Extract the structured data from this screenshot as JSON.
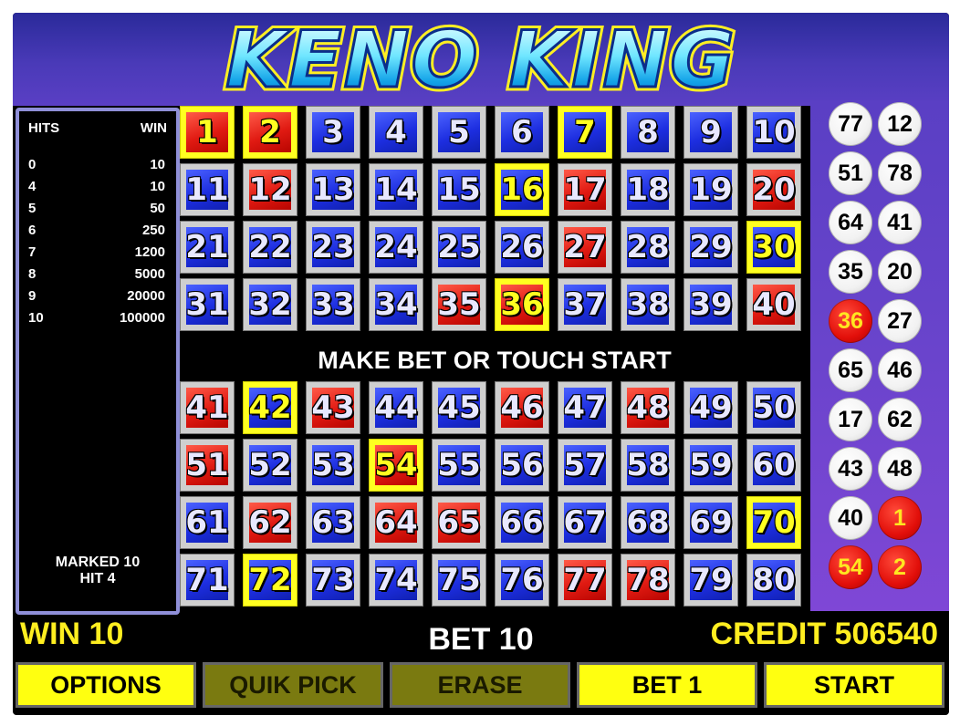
{
  "title": "KENO KING",
  "paytable": {
    "header_hits": "HITS",
    "header_win": "WIN",
    "rows": [
      {
        "hits": "0",
        "win": "10"
      },
      {
        "hits": "4",
        "win": "10"
      },
      {
        "hits": "5",
        "win": "50"
      },
      {
        "hits": "6",
        "win": "250"
      },
      {
        "hits": "7",
        "win": "1200"
      },
      {
        "hits": "8",
        "win": "5000"
      },
      {
        "hits": "9",
        "win": "20000"
      },
      {
        "hits": "10",
        "win": "100000"
      }
    ],
    "marked": "MARKED 10",
    "hit": "HIT 4"
  },
  "board": {
    "message": "MAKE BET OR TOUCH START",
    "drawn": [
      1,
      2,
      12,
      17,
      20,
      27,
      35,
      36,
      40,
      41,
      43,
      46,
      48,
      51,
      54,
      62,
      64,
      65,
      77,
      78
    ],
    "marked": [
      1,
      2,
      7,
      16,
      30,
      36,
      42,
      54,
      70,
      72
    ]
  },
  "drawn_balls": [
    {
      "n": "77",
      "hit": false
    },
    {
      "n": "12",
      "hit": false
    },
    {
      "n": "51",
      "hit": false
    },
    {
      "n": "78",
      "hit": false
    },
    {
      "n": "64",
      "hit": false
    },
    {
      "n": "41",
      "hit": false
    },
    {
      "n": "35",
      "hit": false
    },
    {
      "n": "20",
      "hit": false
    },
    {
      "n": "36",
      "hit": true
    },
    {
      "n": "27",
      "hit": false
    },
    {
      "n": "65",
      "hit": false
    },
    {
      "n": "46",
      "hit": false
    },
    {
      "n": "17",
      "hit": false
    },
    {
      "n": "62",
      "hit": false
    },
    {
      "n": "43",
      "hit": false
    },
    {
      "n": "48",
      "hit": false
    },
    {
      "n": "40",
      "hit": false
    },
    {
      "n": "1",
      "hit": true
    },
    {
      "n": "54",
      "hit": true
    },
    {
      "n": "2",
      "hit": true
    }
  ],
  "status": {
    "win": "WIN 10",
    "bet": "BET 10",
    "credit": "CREDIT 506540"
  },
  "buttons": [
    {
      "label": "OPTIONS",
      "enabled": true
    },
    {
      "label": "QUIK PICK",
      "enabled": false
    },
    {
      "label": "ERASE",
      "enabled": false
    },
    {
      "label": "BET 1",
      "enabled": true
    },
    {
      "label": "START",
      "enabled": true
    }
  ],
  "colors": {
    "cell_blue": "#1d2ee0",
    "cell_red": "#e01a12",
    "marked_yellow": "#ffff20",
    "accent_yellow": "#ffee20",
    "button_disabled": "#7a7a10"
  }
}
